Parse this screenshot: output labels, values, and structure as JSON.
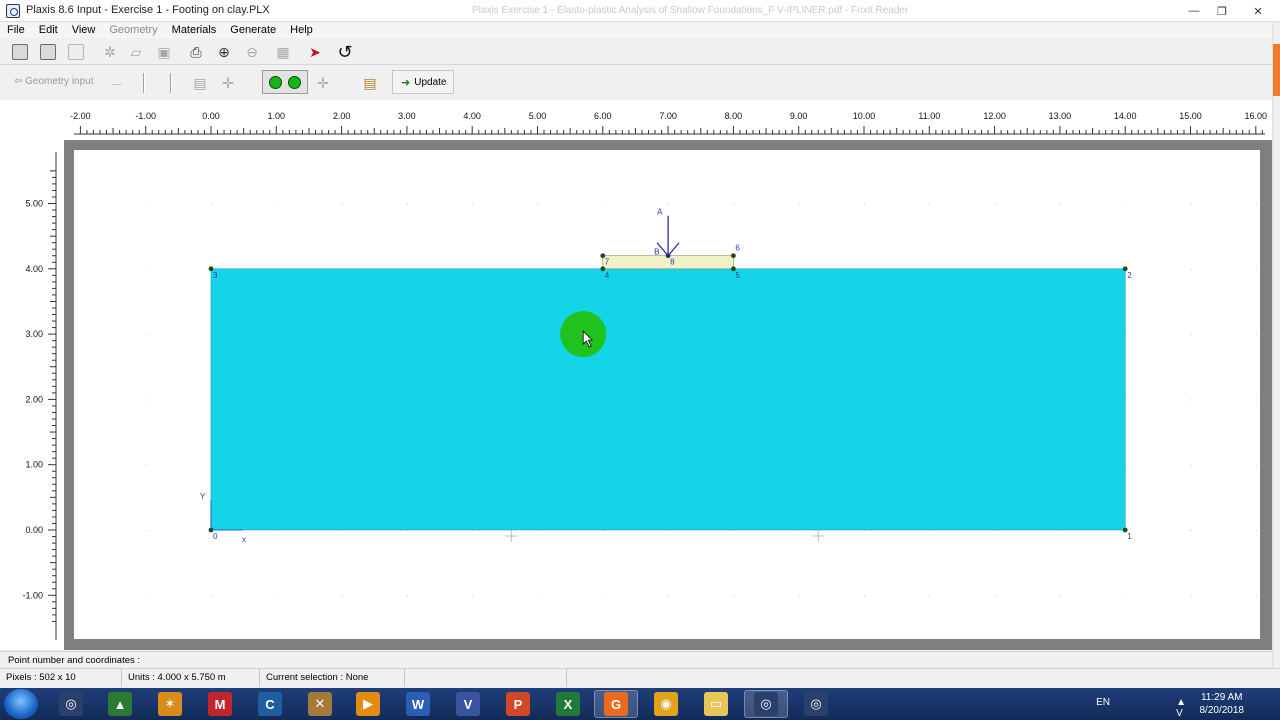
{
  "window": {
    "title": "Plaxis 8.6 Input - Exercise 1 - Footing on clay.PLX",
    "background_title": "Plaxis Exercise 1 - Elasto-plastic Analysis of Shallow Foundations_F V-IPLINER.pdf - Foxit Reader",
    "min_glyph": "—",
    "max_glyph": "❐",
    "close_glyph": "✕"
  },
  "menu": {
    "items": [
      {
        "label": "File",
        "enabled": true
      },
      {
        "label": "Edit",
        "enabled": true
      },
      {
        "label": "View",
        "enabled": true
      },
      {
        "label": "Geometry",
        "enabled": false
      },
      {
        "label": "Materials",
        "enabled": true
      },
      {
        "label": "Generate",
        "enabled": true
      },
      {
        "label": "Help",
        "enabled": true
      }
    ]
  },
  "toolbar2": {
    "geometry_input_label": "⇦ Geometry input",
    "update_label": "Update"
  },
  "ruler": {
    "x_labels": [
      "-2.00",
      "-1.00",
      "0.00",
      "1.00",
      "2.00",
      "3.00",
      "4.00",
      "5.00",
      "6.00",
      "7.00",
      "8.00",
      "9.00",
      "10.00",
      "11.00",
      "12.00",
      "13.00",
      "14.00",
      "15.00",
      "16.00"
    ],
    "y_labels": [
      "5.00",
      "4.00",
      "3.00",
      "2.00",
      "1.00",
      "0.00",
      "-1.00"
    ]
  },
  "model": {
    "soil_color": "#14d4e8",
    "footing_color": "#f3f2c6",
    "point_labels": [
      "0",
      "1",
      "2",
      "3",
      "4",
      "5",
      "6",
      "7",
      "8"
    ],
    "load_label": "A",
    "load_sub_label": "B",
    "axis_x_label": "x",
    "axis_y_label": "Y"
  },
  "status": {
    "point_info": "Point number and coordinates :",
    "pixels": "Pixels : 502 x 10",
    "units": "Units : 4.000 x 5.750 m",
    "selection": "Current selection : None"
  },
  "taskbar": {
    "lang": "EN",
    "tray_icons": "▲ V ▣ ◀ ⚑",
    "time": "11:29 AM",
    "date": "8/20/2018",
    "apps": [
      {
        "name": "plaxis-a",
        "glyph": "◎",
        "color": "#2b3f6b"
      },
      {
        "name": "geo",
        "glyph": "▲",
        "color": "#2a7a36"
      },
      {
        "name": "swirl",
        "glyph": "✶",
        "color": "#d98b1c"
      },
      {
        "name": "mathcad",
        "glyph": "M",
        "color": "#c0262c"
      },
      {
        "name": "cal",
        "glyph": "C",
        "color": "#1f5fa0"
      },
      {
        "name": "tools",
        "glyph": "✕",
        "color": "#a6793b"
      },
      {
        "name": "media",
        "glyph": "▶",
        "color": "#e58b15"
      },
      {
        "name": "word",
        "glyph": "W",
        "color": "#2b5eb4"
      },
      {
        "name": "visio",
        "glyph": "V",
        "color": "#3a55a0"
      },
      {
        "name": "powerpoint",
        "glyph": "P",
        "color": "#d24726"
      },
      {
        "name": "excel",
        "glyph": "X",
        "color": "#1f7a3c"
      },
      {
        "name": "foxit",
        "glyph": "G",
        "color": "#ea6a1f"
      },
      {
        "name": "chrome",
        "glyph": "◉",
        "color": "#e0a31a"
      },
      {
        "name": "explorer",
        "glyph": "▭",
        "color": "#e8c65a"
      },
      {
        "name": "plaxis-b",
        "glyph": "◎",
        "color": "#2b3f6b"
      },
      {
        "name": "plaxis-c",
        "glyph": "◎",
        "color": "#2b3f6b"
      }
    ]
  }
}
